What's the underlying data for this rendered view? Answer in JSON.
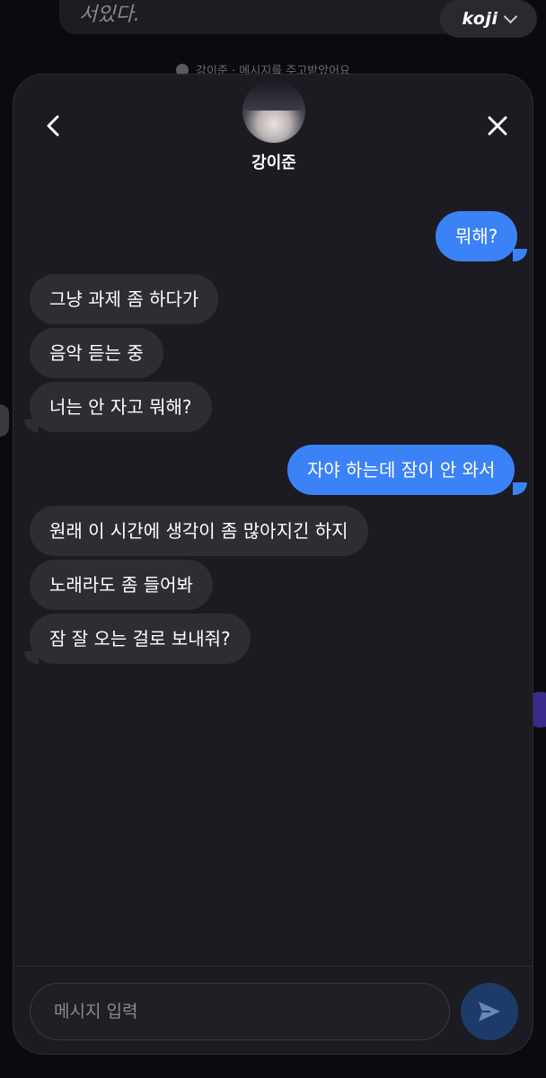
{
  "background": {
    "input_text": "서있다.",
    "brand": "koji",
    "notice": "강이준 · 메시지를 주고받았어요"
  },
  "header": {
    "contact_name": "강이준"
  },
  "messages": [
    {
      "sender": "me",
      "text": "뭐해?"
    },
    {
      "sender": "them",
      "text": "그냥 과제 좀 하다가"
    },
    {
      "sender": "them",
      "text": "음악 듣는 중"
    },
    {
      "sender": "them",
      "text": "너는 안 자고 뭐해?"
    },
    {
      "sender": "me",
      "text": "자야 하는데 잠이 안 와서"
    },
    {
      "sender": "them",
      "text": "원래 이 시간에 생각이 좀 많아지긴 하지"
    },
    {
      "sender": "them",
      "text": "노래라도 좀 들어봐"
    },
    {
      "sender": "them",
      "text": "잠 잘 오는 걸로 보내줘?"
    }
  ],
  "composer": {
    "placeholder": "메시지 입력"
  },
  "colors": {
    "outgoing": "#3b82f6",
    "incoming": "#2d2d33",
    "modal_bg": "#1b1b21",
    "send_button": "#1e3a68"
  }
}
